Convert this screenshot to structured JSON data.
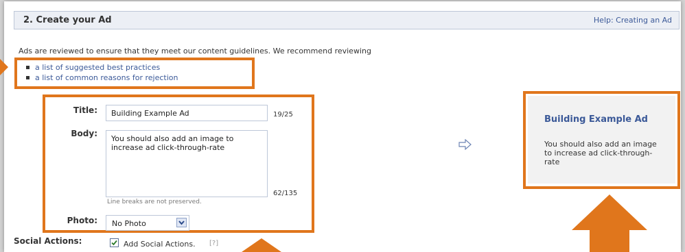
{
  "header": {
    "title": "2. Create your Ad",
    "help_link": "Help: Creating an Ad"
  },
  "intro_text": "Ads are reviewed to ensure that they meet our content guidelines. We recommend reviewing",
  "links": [
    {
      "label": "a list of suggested best practices"
    },
    {
      "label": "a list of common reasons for rejection"
    }
  ],
  "form": {
    "title_label": "Title:",
    "title_value": "Building Example Ad",
    "title_count": "19/25",
    "body_label": "Body:",
    "body_value": "You should also add an image to increase ad click-through-rate",
    "body_count": "62/135",
    "body_note": "Line breaks are not preserved.",
    "photo_label": "Photo:",
    "photo_value": "No Photo",
    "social_label": "Social Actions:",
    "social_checkbox_label": "Add Social Actions.",
    "social_help": "[?]",
    "social_checked": true
  },
  "preview": {
    "title": "Building Example Ad",
    "body": "You should also add an image to increase ad click-through-rate"
  },
  "colors": {
    "highlight": "#e0761c",
    "link": "#3b5998",
    "header_bg": "#eceff5"
  },
  "icons": {
    "preview_arrow": "right-arrow-outline-icon",
    "dropdown": "chevron-down-icon",
    "checkbox": "checkmark-icon"
  }
}
